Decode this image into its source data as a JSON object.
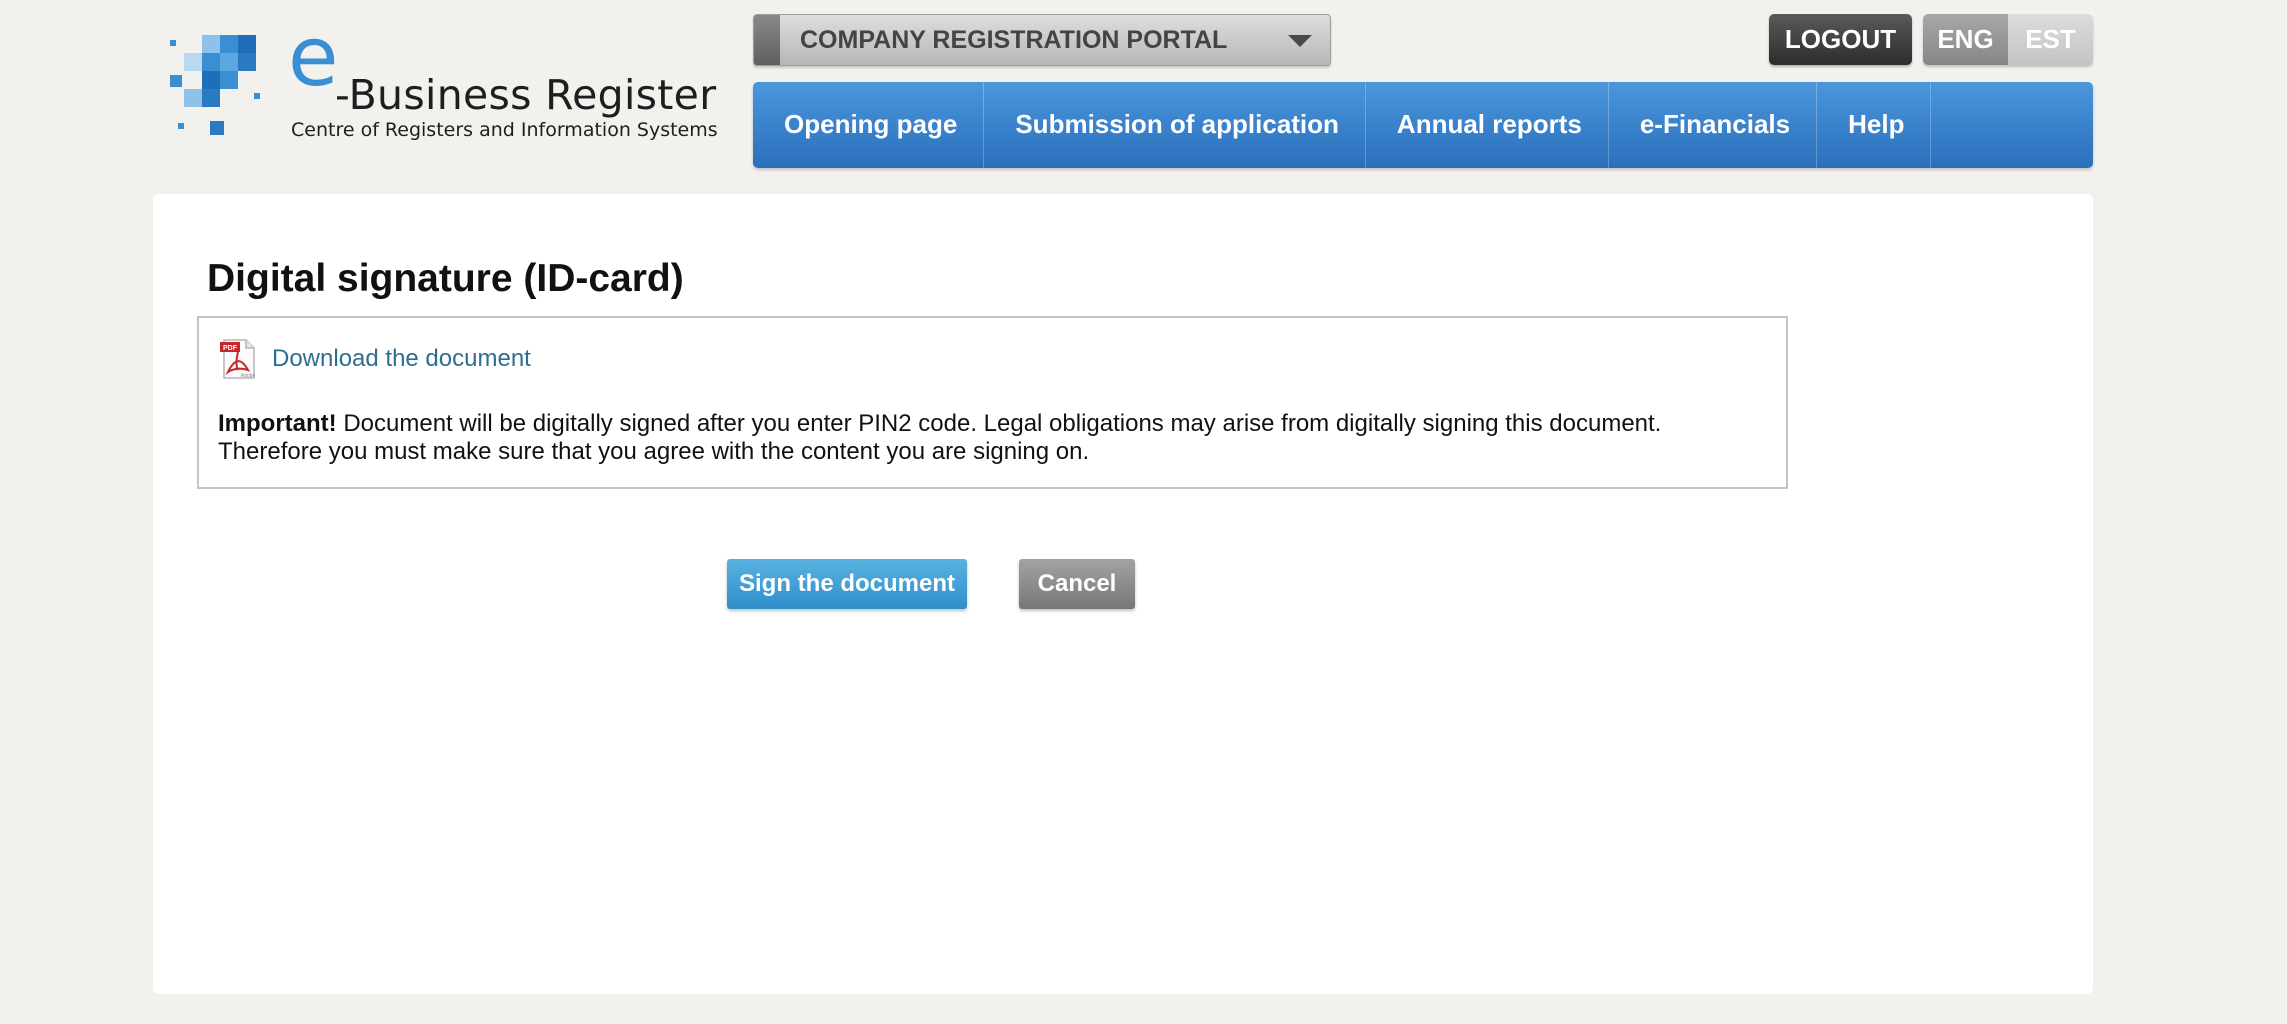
{
  "header": {
    "logo": {
      "letter": "e",
      "name": "-Business Register",
      "subtitle": "Centre of Registers and Information Systems",
      "icon": "pixel-squares-logo"
    },
    "portal_select": {
      "label": "COMPANY REGISTRATION PORTAL",
      "icon": "chevron-down-icon"
    },
    "logout_label": "LOGOUT",
    "languages": [
      {
        "label": "ENG",
        "active": true
      },
      {
        "label": "EST",
        "active": false
      }
    ]
  },
  "nav": {
    "items": [
      {
        "label": "Opening page"
      },
      {
        "label": "Submission of application"
      },
      {
        "label": "Annual reports"
      },
      {
        "label": "e-Financials"
      },
      {
        "label": "Help"
      }
    ]
  },
  "main": {
    "title": "Digital signature (ID-card)",
    "download": {
      "label": "Download the document",
      "icon": "pdf-file-icon",
      "icon_badge": "PDF",
      "icon_caption": "Adobe"
    },
    "notice": {
      "strong": "Important!",
      "line1": " Document will be digitally signed after you enter PIN2 code. Legal obligations may arise from digitally signing this document.",
      "line2": "Therefore you must make sure that you agree with the content you are signing on."
    },
    "buttons": {
      "sign": "Sign the document",
      "cancel": "Cancel"
    }
  },
  "colors": {
    "background": "#f2f1ed",
    "nav_blue": "#3a84cc",
    "accent_blue": "#3a8ed3",
    "link": "#2e6e8e",
    "sign_button": "#3d9fd4",
    "cancel_button": "#8c8c8c",
    "logout_button": "#3a3a3a"
  }
}
